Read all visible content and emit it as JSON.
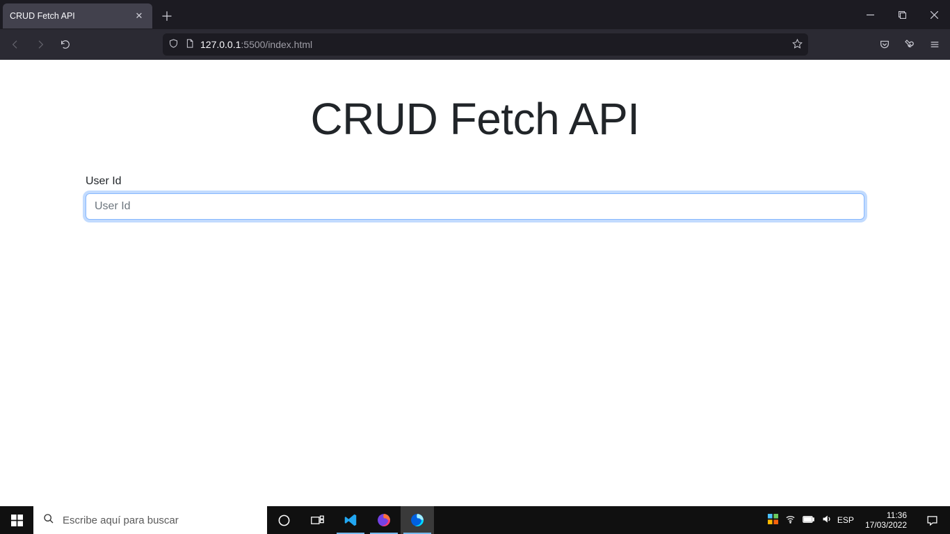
{
  "browser": {
    "tab_title": "CRUD Fetch API",
    "url_host": "127.0.0.1",
    "url_port_path": ":5500/index.html"
  },
  "page": {
    "title": "CRUD Fetch API",
    "form": {
      "userid_label": "User Id",
      "userid_placeholder": "User Id",
      "userid_value": ""
    }
  },
  "taskbar": {
    "search_placeholder": "Escribe aquí para buscar",
    "lang": "ESP",
    "time": "11:36",
    "date": "17/03/2022"
  }
}
